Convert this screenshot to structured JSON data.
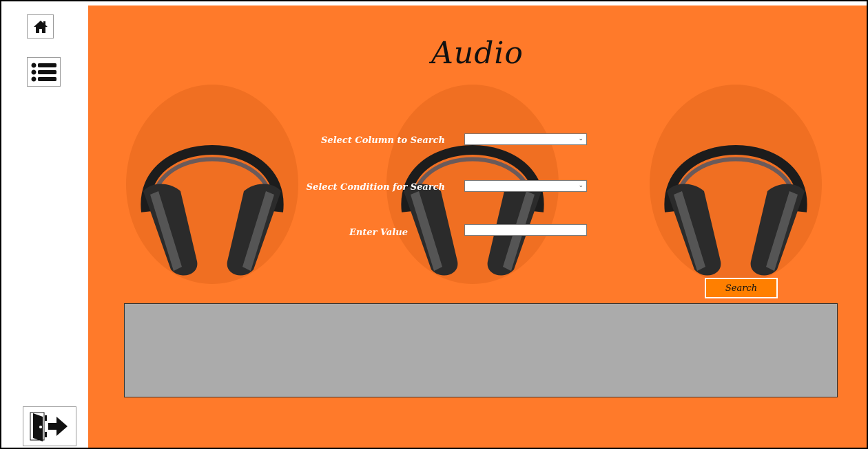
{
  "page": {
    "title": "Audio"
  },
  "sidebar": {
    "home_icon": "home-icon",
    "menu_icon": "list-menu-icon",
    "exit_icon": "exit-door-icon"
  },
  "form": {
    "column_label": "Select Column to Search",
    "column_value": "",
    "condition_label": "Select Condition for Search",
    "condition_value": "",
    "value_label": "Enter Value",
    "value_text": ""
  },
  "search_button": {
    "label": "Search"
  },
  "results": {
    "rows": []
  },
  "colors": {
    "background": "#ff7a2a",
    "search_button": "#ff7f00",
    "results_grid": "#ababab"
  }
}
